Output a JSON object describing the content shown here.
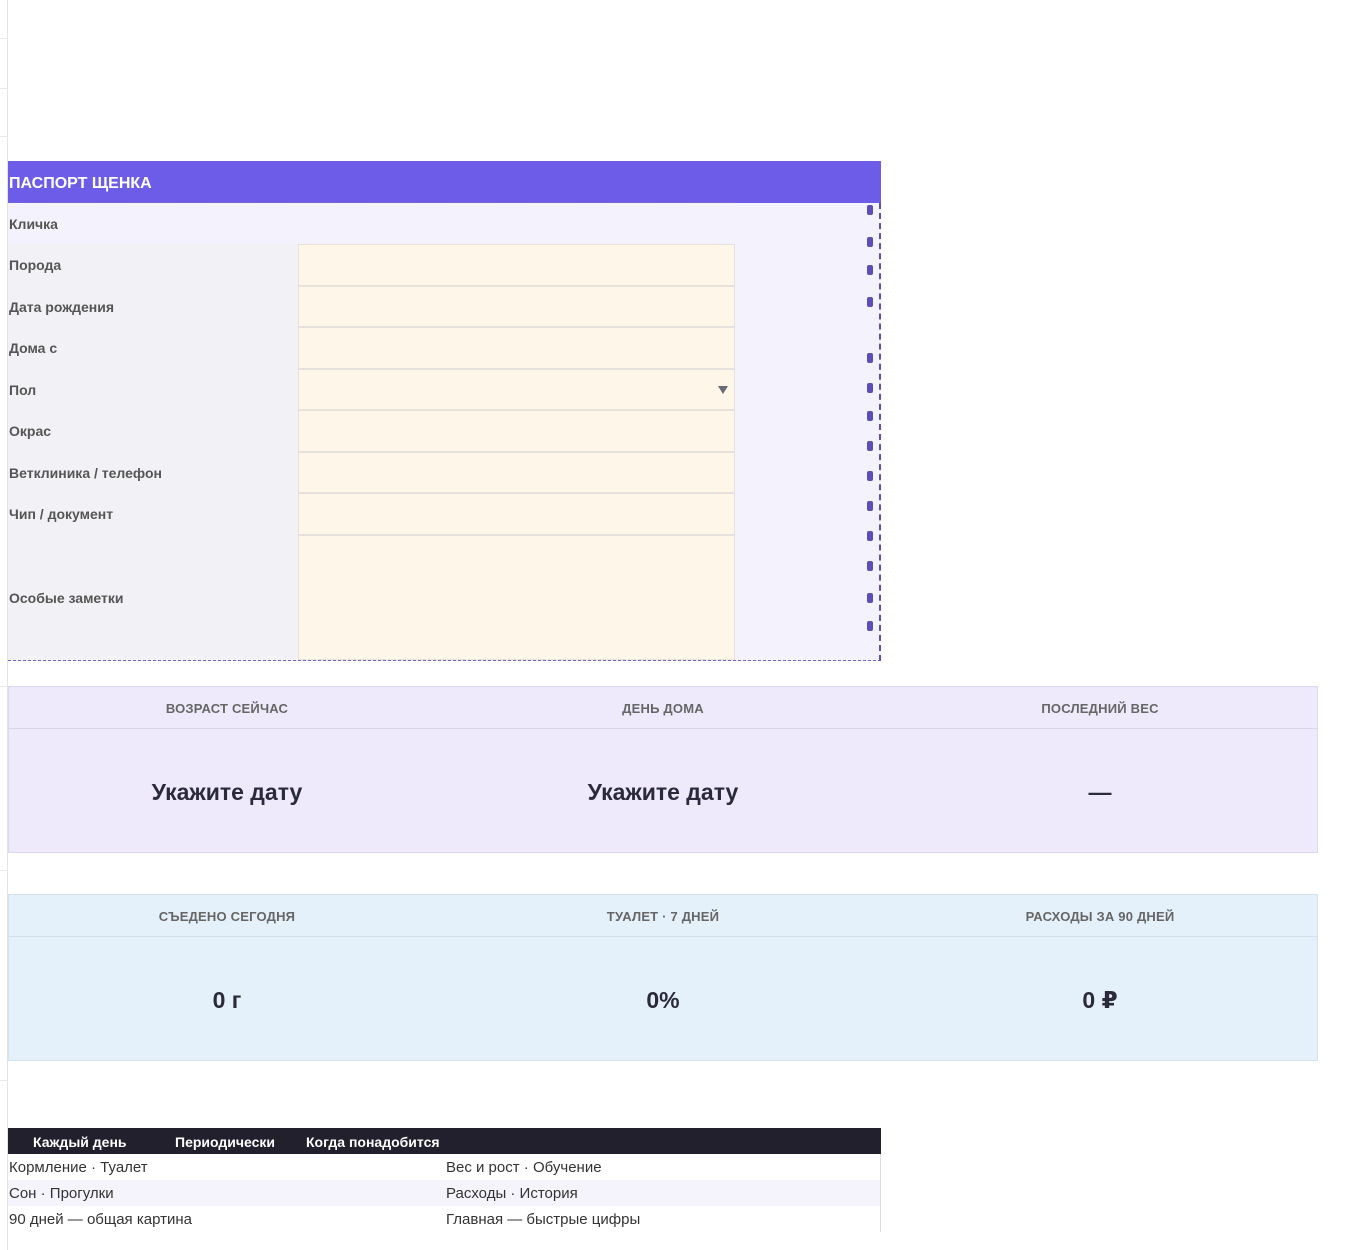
{
  "passport": {
    "title": "ПАСПОРТ ЩЕНКА",
    "fields": [
      {
        "label": "Кличка",
        "value": ""
      },
      {
        "label": "Порода",
        "value": ""
      },
      {
        "label": "Дата рождения",
        "value": ""
      },
      {
        "label": "Дома с",
        "value": ""
      },
      {
        "label": "Пол",
        "value": "",
        "type": "dropdown"
      },
      {
        "label": "Окрас",
        "value": ""
      },
      {
        "label": "Ветклиника / телефон",
        "value": ""
      },
      {
        "label": "Чип / документ",
        "value": ""
      },
      {
        "label": "Особые заметки",
        "value": ""
      }
    ]
  },
  "stats_row_1": {
    "items": [
      {
        "label": "ВОЗРАСТ СЕЙЧАС",
        "value": "Укажите дату"
      },
      {
        "label": "ДЕНЬ ДОМА",
        "value": "Укажите дату"
      },
      {
        "label": "ПОСЛЕДНИЙ ВЕС",
        "value": "—"
      }
    ]
  },
  "stats_row_2": {
    "items": [
      {
        "label": "СЪЕДЕНО СЕГОДНЯ",
        "value": "0 г"
      },
      {
        "label": "ТУАЛЕТ · 7 ДНЕЙ",
        "value": "0%"
      },
      {
        "label": "РАСХОДЫ ЗА 90 ДНЕЙ",
        "value": "0 ₽"
      }
    ]
  },
  "navigation": {
    "headers": [
      "Каждый день",
      "Периодически",
      "Когда понадобится"
    ],
    "rows": [
      [
        "Кормление · Туалет",
        "Вес и рост · Обучение"
      ],
      [
        "Сон · Прогулки",
        "Расходы · История"
      ],
      [
        "90 дней — общая картина",
        "Главная — быстрые цифры"
      ]
    ]
  },
  "colors": {
    "header_purple": "#6c5ce7",
    "input_fill": "#fef6e9",
    "kpi_purple": "#eeeafc",
    "kpi_blue": "#e4f0fa",
    "nav_header": "#22202c"
  }
}
